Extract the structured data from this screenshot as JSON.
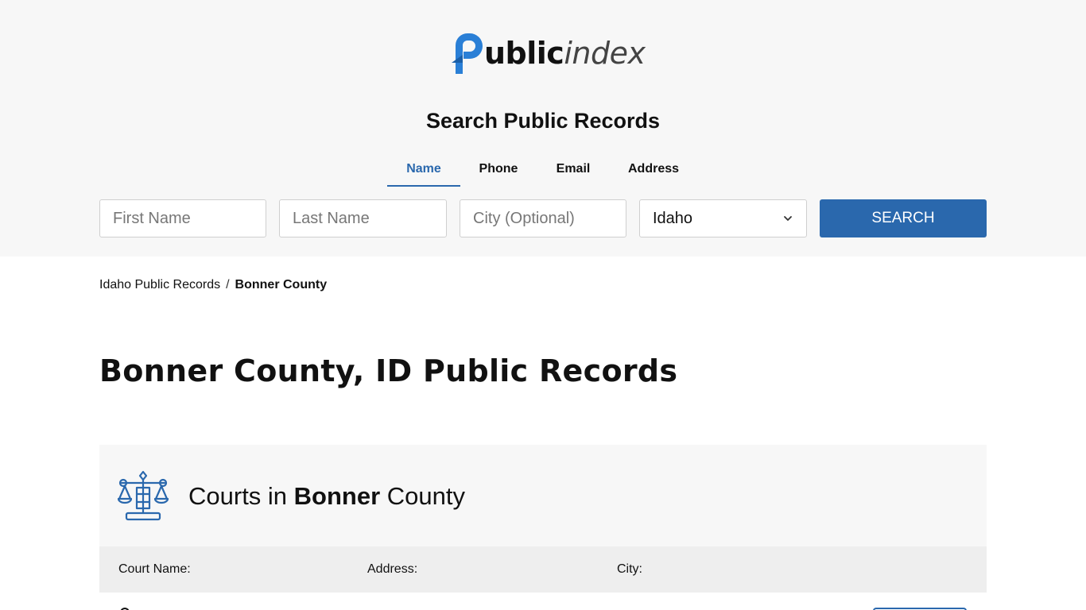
{
  "brand": {
    "logo_word1": "ublic",
    "logo_word2": "index",
    "accent_color": "#2a68ad"
  },
  "search": {
    "title": "Search Public Records",
    "tabs": [
      {
        "label": "Name",
        "active": true
      },
      {
        "label": "Phone",
        "active": false
      },
      {
        "label": "Email",
        "active": false
      },
      {
        "label": "Address",
        "active": false
      }
    ],
    "first_name_placeholder": "First Name",
    "last_name_placeholder": "Last Name",
    "city_placeholder": "City (Optional)",
    "state_value": "Idaho",
    "button_label": "SEARCH"
  },
  "breadcrumb": {
    "parent": "Idaho Public Records",
    "separator": "/",
    "current": "Bonner County"
  },
  "page": {
    "title": "Bonner County, ID Public Records"
  },
  "courts": {
    "title_prefix": "Courts in",
    "county": "Bonner",
    "title_suffix": "County",
    "columns": [
      "Court Name:",
      "Address:",
      "City:"
    ]
  }
}
